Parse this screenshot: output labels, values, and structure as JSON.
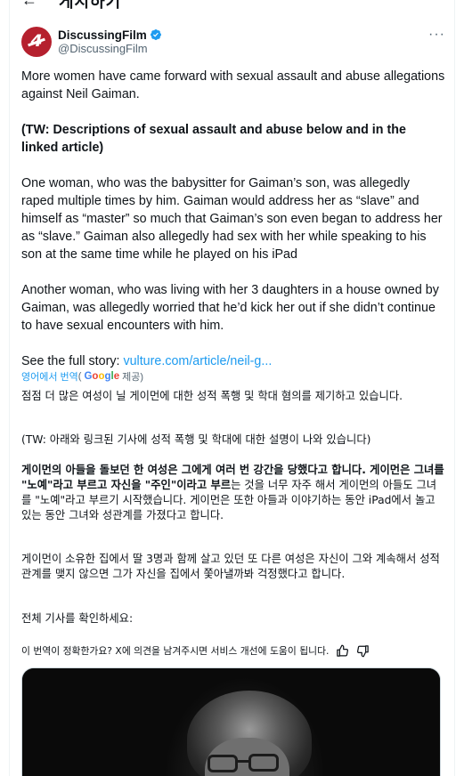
{
  "topbar": {
    "back_icon": "arrow-left-icon",
    "title": "게시하기"
  },
  "author": {
    "display_name": "DiscussingFilm",
    "handle": "@DiscussingFilm",
    "verified": true,
    "avatar_icon": "discussingfilm-logo",
    "more_icon": "more-dots-icon",
    "more_label": "···"
  },
  "tweet": {
    "p1": "More women have came forward with sexual assault and abuse allegations against Neil Gaiman.",
    "p2": "(TW: Descriptions of sexual assault and abuse below and in the linked article)",
    "p3": "One woman, who was the babysitter for Gaiman’s son, was allegedly raped multiple times by him. Gaiman would address her as “slave” and himself as “master” so much that Gaiman’s son even began to address her as “slave.” Gaiman also allegedly had sex with her while speaking to his son at the same time while he played on his iPad",
    "p4": "Another woman, who was living with her 3 daughters in a house owned by Gaiman, was allegedly worried that he’d kick her out if she didn’t continue to have sexual encounters with him.",
    "p5_prefix": "See the full story: ",
    "p5_link": "vulture.com/article/neil-g..."
  },
  "translation": {
    "translated_from": "영어에서 번역",
    "paren_open": "(",
    "google": "Google",
    "provided": " 제공)",
    "ko1": "점점 더 많은 여성이 닐 게이먼에 대한 성적 폭행 및 학대 혐의를 제기하고 있습니다.",
    "ko2": "(TW: 아래와 링크된 기사에 성적 폭행 및 학대에 대한 설명이 나와 있습니다)",
    "ko3_bold1": "게이먼의 아들을 돌보던 한 여성은 그에게 여러 번 강간을 당했다고 합니다. 게이먼은 그녀를 \"노예\"라고 부르고 자신을 \"주인\"이라고 부르",
    "ko3_rest": "는 것을 너무 자주 해서 게이먼의 아들도 그녀를 \"노예\"라고 부르기 시작했습니다. 게이먼은 또한 아들과 이야기하는 동안 iPad에서 놀고 있는 동안 그녀와 성관계를 가졌다고 합니다.",
    "ko4": "게이먼이 소유한 집에서 딸 3명과 함께 살고 있던 또 다른 여성은 자신이 그와 계속해서 성적 관계를 맺지 않으면 그가 자신을 집에서 쫓아낼까봐 걱정했다고 합니다.",
    "ko5": "전체 기사를 확인하세요:",
    "feedback": "이 번역이 정확한가요? X에 의견을 남겨주시면 서비스 개선에 도움이 됩니다.",
    "thumbs_up_icon": "thumbs-up-icon",
    "thumbs_down_icon": "thumbs-down-icon"
  },
  "media": {
    "description_icon": "photo-thumbnail"
  },
  "colors": {
    "link": "#1d9bf0",
    "secondary_text": "#536471",
    "primary_text": "#0f1419",
    "avatar_bg": "#b5202e"
  }
}
